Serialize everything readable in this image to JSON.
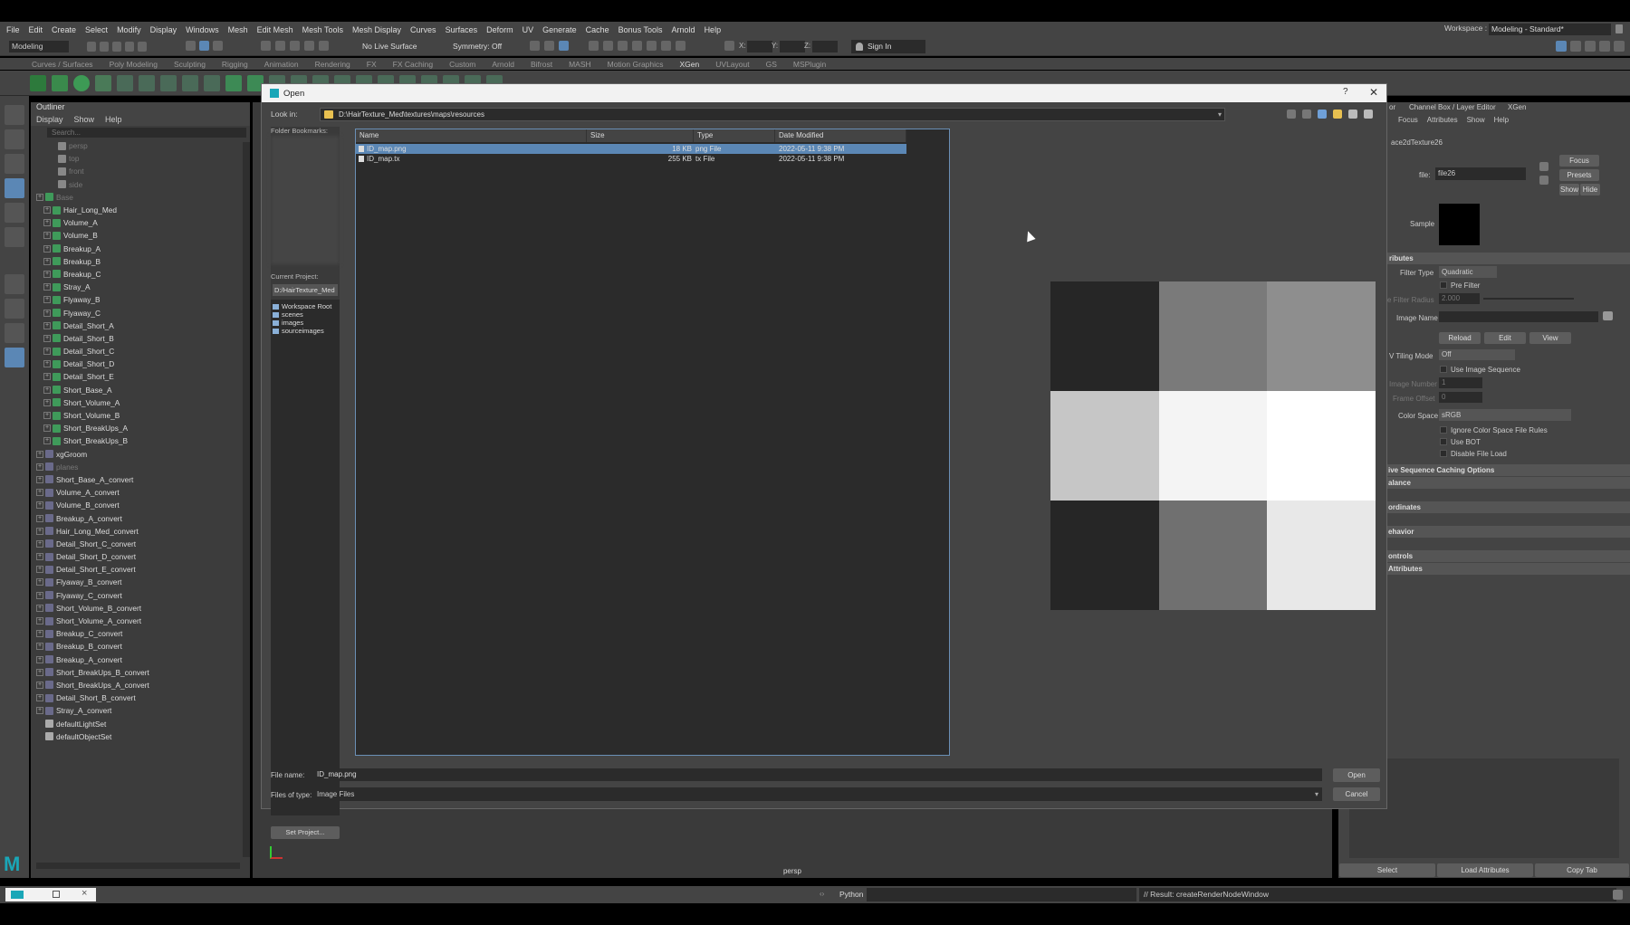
{
  "menubar": {
    "items": [
      "File",
      "Edit",
      "Create",
      "Select",
      "Modify",
      "Display",
      "Windows",
      "Mesh",
      "Edit Mesh",
      "Mesh Tools",
      "Mesh Display",
      "Curves",
      "Surfaces",
      "Deform",
      "UV",
      "Generate",
      "Cache",
      "Bonus Tools",
      "Arnold",
      "Help"
    ],
    "workspace_label": "Workspace :",
    "workspace_value": "Modeling - Standard*"
  },
  "statusline": {
    "mode": "Modeling",
    "live_surface": "No Live Surface",
    "symmetry": "Symmetry: Off",
    "x_label": "X:",
    "y_label": "Y:",
    "z_label": "Z:",
    "sign_in": "Sign In"
  },
  "shelf_tabs": [
    "Curves / Surfaces",
    "Poly Modeling",
    "Sculpting",
    "Rigging",
    "Animation",
    "Rendering",
    "FX",
    "FX Caching",
    "Custom",
    "Arnold",
    "Bifrost",
    "MASH",
    "Motion Graphics",
    "XGen",
    "UVLayout",
    "GS",
    "MSPlugin"
  ],
  "shelf_active_tab": "XGen",
  "outliner": {
    "title": "Outliner",
    "menu": [
      "Display",
      "Show",
      "Help"
    ],
    "search_placeholder": "Search...",
    "cameras": [
      "persp",
      "top",
      "front",
      "side"
    ],
    "group": "Base",
    "children": [
      "Hair_Long_Med",
      "Volume_A",
      "Volume_B",
      "Breakup_A",
      "Breakup_B",
      "Breakup_C",
      "Stray_A",
      "Flyaway_B",
      "Flyaway_C",
      "Detail_Short_A",
      "Detail_Short_B",
      "Detail_Short_C",
      "Detail_Short_D",
      "Detail_Short_E",
      "Short_Base_A",
      "Short_Volume_A",
      "Short_Volume_B",
      "Short_BreakUps_A",
      "Short_BreakUps_B"
    ],
    "top_items": [
      "xgGroom",
      "planes",
      "Short_Base_A_convert",
      "Volume_A_convert",
      "Volume_B_convert",
      "Breakup_A_convert",
      "Hair_Long_Med_convert",
      "Detail_Short_C_convert",
      "Detail_Short_D_convert",
      "Detail_Short_E_convert",
      "Flyaway_B_convert",
      "Flyaway_C_convert",
      "Short_Volume_B_convert",
      "Short_Volume_A_convert",
      "Breakup_C_convert",
      "Breakup_B_convert",
      "Breakup_A_convert",
      "Short_BreakUps_B_convert",
      "Short_BreakUps_A_convert",
      "Detail_Short_B_convert",
      "Stray_A_convert"
    ],
    "sets": [
      "defaultLightSet",
      "defaultObjectSet"
    ]
  },
  "viewport": {
    "camera_label": "persp"
  },
  "attribute_editor": {
    "tabs": [
      "or",
      "Channel Box / Layer Editor",
      "XGen"
    ],
    "menu": [
      "Focus",
      "Attributes",
      "Show",
      "Help"
    ],
    "node_name": "ace2dTexture26",
    "file_label": "file:",
    "file_value": "file26",
    "focus_button": "Focus",
    "presets_button": "Presets",
    "show_button": "Show",
    "hide_button": "Hide",
    "sample_label": "Sample",
    "section_attributes": "ributes",
    "filter_type_label": "Filter Type",
    "filter_type_value": "Quadratic",
    "pre_filter_label": "Pre Filter",
    "pre_filter_radius_label": "e Filter Radius",
    "pre_filter_radius_value": "2.000",
    "image_name_label": "Image Name",
    "reload_button": "Reload",
    "edit_button": "Edit",
    "view_button": "View",
    "uv_tiling_label": "V Tiling Mode",
    "uv_tiling_value": "Off",
    "use_image_sequence": "Use Image Sequence",
    "image_number_label": "Image Number",
    "image_number_value": "1",
    "frame_offset_label": "Frame Offset",
    "frame_offset_value": "0",
    "color_space_label": "Color Space",
    "color_space_value": "sRGB",
    "ignore_rules": "Ignore Color Space File Rules",
    "use_bot": "Use BOT",
    "disable_file_load": "Disable File Load",
    "sections": [
      "ive Sequence Caching Options",
      "alance",
      "ordinates",
      "ehavior",
      "ontrols",
      "Attributes"
    ],
    "select_button": "Select",
    "load_attributes_button": "Load Attributes",
    "copy_tab_button": "Copy Tab"
  },
  "cmdline": {
    "language": "Python",
    "result": "// Result: createRenderNodeWindow"
  },
  "dialog": {
    "title": "Open",
    "help_glyph": "?",
    "close_glyph": "✕",
    "look_in_label": "Look in:",
    "look_in_path": "D:\\HairTexture_Med\\textures\\maps\\resources",
    "folder_bookmarks_label": "Folder Bookmarks:",
    "current_project_label": "Current Project:",
    "current_project_value": "D:/HairTexture_Med",
    "project_folders": [
      "Workspace Root",
      "scenes",
      "images",
      "sourceimages"
    ],
    "set_project_button": "Set Project...",
    "columns": [
      "Name",
      "Size",
      "Type",
      "Date Modified"
    ],
    "files": [
      {
        "name": "ID_map.png",
        "size": "18 KB",
        "type": "png File",
        "date": "2022-05-11 9:38 PM",
        "selected": true
      },
      {
        "name": "ID_map.tx",
        "size": "255 KB",
        "type": "tx File",
        "date": "2022-05-11 9:38 PM",
        "selected": false
      }
    ],
    "preview_cells": [
      "#262626",
      "#7a7a7a",
      "#8e8e8e",
      "#c6c6c6",
      "#f4f4f4",
      "#ffffff",
      "#262626",
      "#707070",
      "#e8e8e8"
    ],
    "file_name_label": "File name:",
    "file_name_value": "ID_map.png",
    "files_of_type_label": "Files of type:",
    "files_of_type_value": "Image Files",
    "open_button": "Open",
    "cancel_button": "Cancel"
  },
  "colors": {
    "selection": "#5b87b5",
    "maya_logo": "#1aa6b7",
    "outliner_icon_green": "#3f9a5a"
  }
}
